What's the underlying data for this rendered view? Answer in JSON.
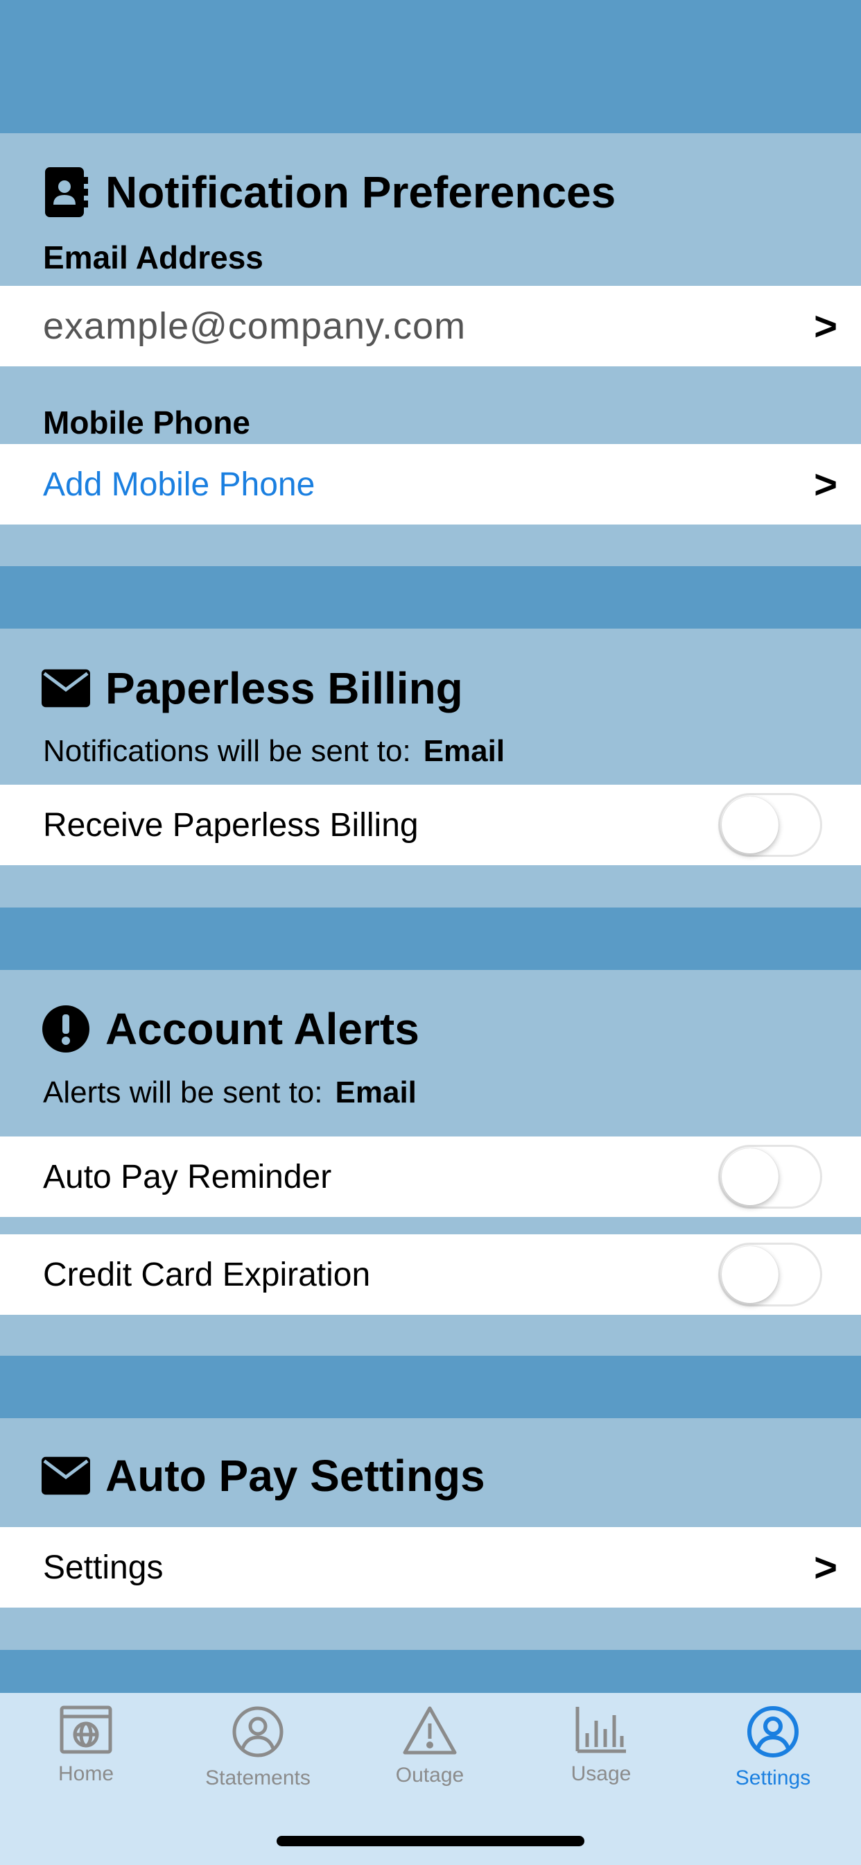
{
  "notification": {
    "title": "Notification Preferences",
    "email_label": "Email Address",
    "email_placeholder": "example@company.com",
    "mobile_label": "Mobile Phone",
    "mobile_link": "Add Mobile Phone",
    "chevron": ">"
  },
  "paperless": {
    "title": "Paperless Billing",
    "sent_to_label": "Notifications will be sent to:",
    "sent_to_value": "Email",
    "receive_label": "Receive Paperless Billing",
    "receive_on": false
  },
  "alerts": {
    "title": "Account Alerts",
    "sent_to_label": "Alerts will be sent to:",
    "sent_to_value": "Email",
    "items": [
      {
        "label": "Auto Pay Reminder",
        "on": false
      },
      {
        "label": "Credit Card Expiration",
        "on": false
      }
    ]
  },
  "autopay": {
    "title": "Auto Pay Settings",
    "settings_label": "Settings",
    "chevron": ">"
  },
  "tabbar": {
    "items": [
      {
        "label": "Home",
        "icon": "browser-globe-icon",
        "active": false
      },
      {
        "label": "Statements",
        "icon": "user-circle-icon",
        "active": false
      },
      {
        "label": "Outage",
        "icon": "warning-triangle-icon",
        "active": false
      },
      {
        "label": "Usage",
        "icon": "bar-chart-icon",
        "active": false
      },
      {
        "label": "Settings",
        "icon": "user-circle-icon",
        "active": true
      }
    ]
  },
  "colors": {
    "band": "#5a9bc6",
    "panel": "#9bc0d8",
    "link": "#1a7fe0",
    "tabbar": "#cfe4f4",
    "inactive_tab": "#8b8b8b"
  }
}
